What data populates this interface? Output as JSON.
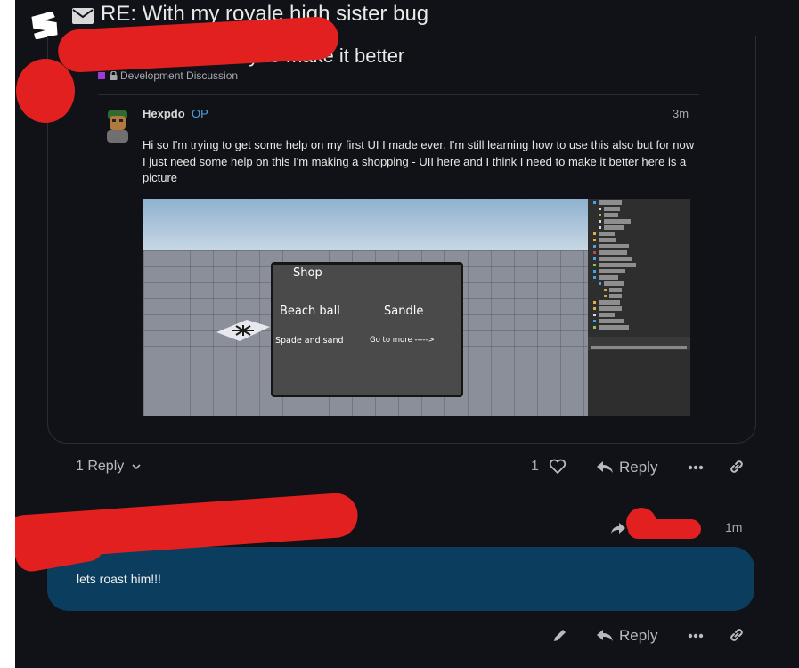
{
  "topic": {
    "title": "RE: With my royale high sister bug"
  },
  "original_post": {
    "title_visible": "ake, UI better. I will try to make it better",
    "category": "Development Discussion",
    "author": "Hexpdo",
    "badge": "OP",
    "time": "3m",
    "body": "Hi so I'm trying to get some help on my first UI I made ever. I'm still learning how to use this also but for now I just need some help on this I'm making a shopping - UII here and I think I need to make it better here is a picture",
    "image": {
      "gui_title": "Shop",
      "button_1": "Beach ball",
      "button_2": "Sandle",
      "button_3": "Spade and sand",
      "button_4": "Go to more ----->"
    }
  },
  "post_actions": {
    "replies": "1 Reply",
    "like_count": "1",
    "reply_label": "Reply"
  },
  "reply_post": {
    "time": "1m",
    "body": "lets roast him!!!",
    "reply_label": "Reply"
  },
  "colors": {
    "background": "#111217",
    "reply_bubble": "#0b3e5e",
    "op_badge": "#4ea3e6",
    "category": "#9c3bd9",
    "redaction": "#e32020"
  },
  "icons": [
    "forum-logo-icon",
    "mail-icon",
    "lock-icon",
    "chevron-down-icon",
    "heart-icon",
    "reply-arrow-icon",
    "more-icon",
    "link-icon",
    "edit-icon",
    "reply-to-icon"
  ]
}
